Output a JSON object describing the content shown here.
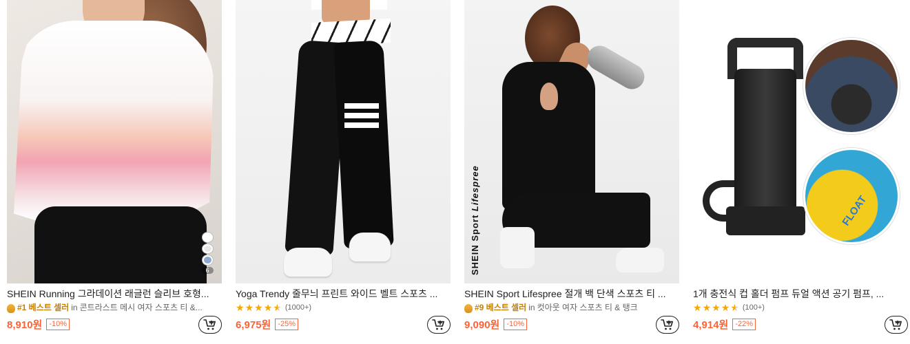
{
  "products": [
    {
      "title": "SHEIN Running 그라데이션 래글런 슬리브 호형...",
      "rank": "#1 베스트 셀러",
      "in_text": "in",
      "category": "콘트라스트 메시 여자 스포츠 티 &...",
      "price": "8,910원",
      "discount": "-10%",
      "swatch_colors": [
        "#ffffff",
        "#e9e6ea",
        "#8fa9cf"
      ],
      "swatch_more": "6"
    },
    {
      "title": "Yoga Trendy 줄무늬 프린트 와이드 벨트 스포츠 ...",
      "rating": 4.5,
      "review_count": "(1000+)",
      "price": "6,975원",
      "discount": "-25%"
    },
    {
      "title": "SHEIN Sport Lifespree 절개 백 단색 스포츠 티 ...",
      "rank": "#9 베스트 셀러",
      "in_text": "in",
      "category": "컷아웃 여자 스포츠 티 & 탱크",
      "price": "9,090원",
      "discount": "-10%",
      "brand_mark_1": "SHEIN Sport",
      "brand_mark_2": "Lifespree"
    },
    {
      "title": "1개 충전식 컵 홀더 펌프 듀얼 액션 공기 펌프, ...",
      "rating": 4.5,
      "review_count": "(100+)",
      "price": "4,914원",
      "discount": "-22%",
      "inset_text": "FLOAT"
    }
  ],
  "colors": {
    "price": "#fa6338",
    "rank": "#c77f00",
    "star": "#f6a700"
  },
  "icons": {
    "cart": "add-to-cart-icon",
    "medal": "best-seller-medal-icon",
    "star": "star-icon"
  }
}
